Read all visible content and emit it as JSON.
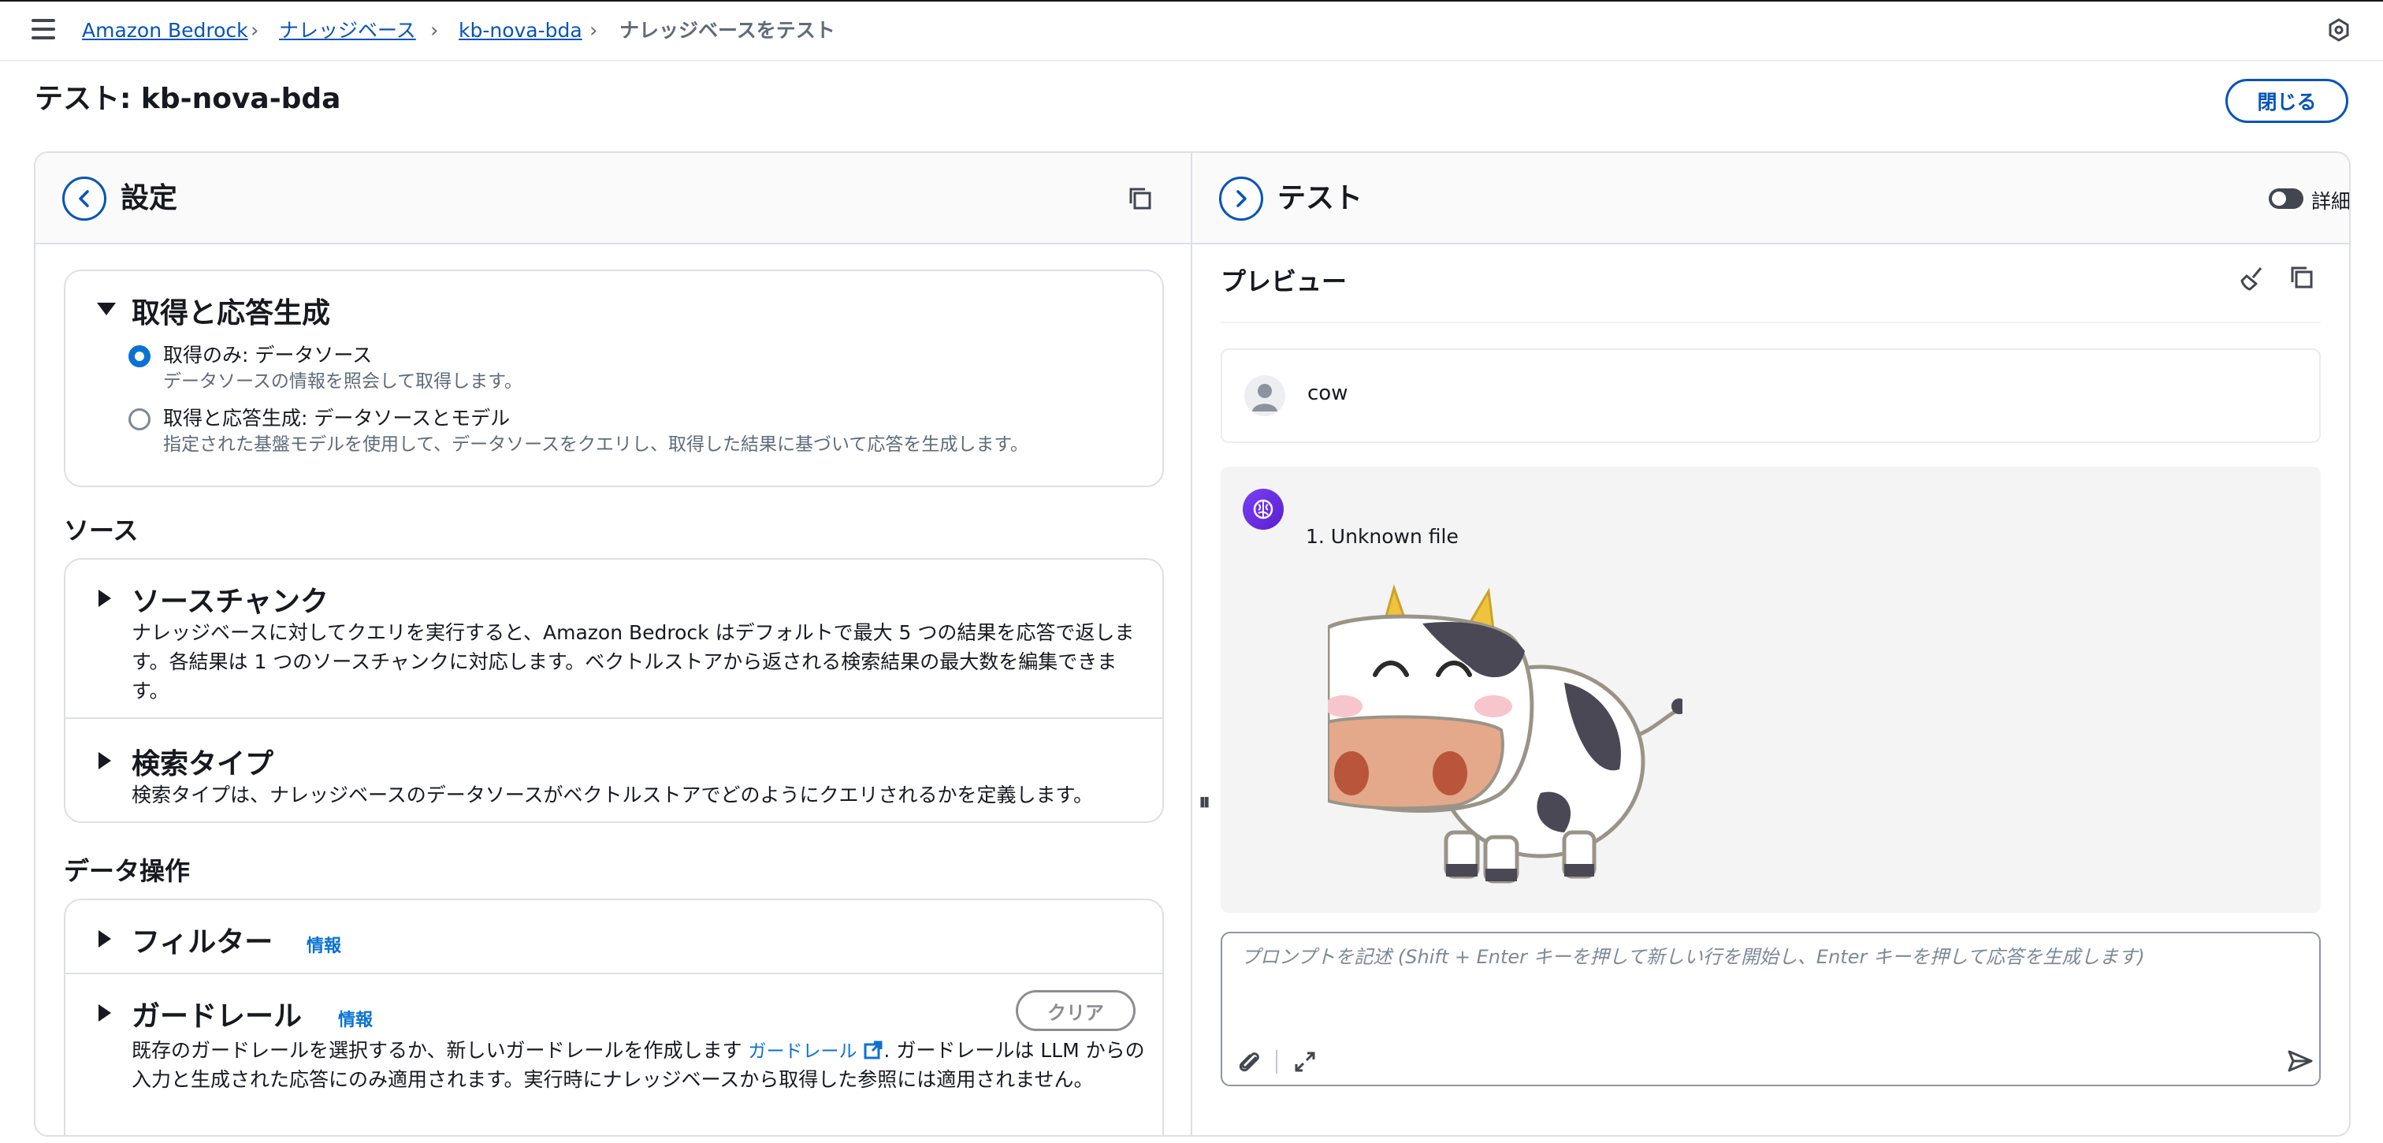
{
  "breadcrumbs": [
    "Amazon Bedrock",
    "ナレッジベース",
    "kb-nova-bda",
    "ナレッジベースをテスト"
  ],
  "page": {
    "title": "テスト: kb-nova-bda",
    "close_label": "閉じる"
  },
  "config_pane": {
    "title": "設定",
    "retrieval": {
      "title": "取得と応答生成",
      "options": [
        {
          "label": "取得のみ: データソース",
          "desc": "データソースの情報を照会して取得します。",
          "selected": true
        },
        {
          "label": "取得と応答生成: データソースとモデル",
          "desc": "指定された基盤モデルを使用して、データソースをクエリし、取得した結果に基づいて応答を生成します。",
          "selected": false
        }
      ]
    },
    "source": {
      "heading": "ソース",
      "chunks_title": "ソースチャンク",
      "chunks_desc_1": "ナレッジベースに対してクエリを実行すると、Amazon Bedrock はデフォルトで最大 5 つの結果を応答で返しま",
      "chunks_desc_2": "す。各結果は 1 つのソースチャンクに対応します。ベクトルストアから返される検索結果の最大数を編集できま",
      "chunks_desc_3": "す。",
      "search_title": "検索タイプ",
      "search_desc": "検索タイプは、ナレッジベースのデータソースがベクトルストアでどのようにクエリされるかを定義します。"
    },
    "data_ops": {
      "heading": "データ操作",
      "filter_title": "フィルター",
      "filter_info": "情報",
      "guardrail_title": "ガードレール",
      "guardrail_info": "情報",
      "clear_label": "クリア",
      "guardrail_desc_1": "既存のガードレールを選択するか、新しいガードレールを作成します",
      "guardrail_link": "ガードレール",
      "guardrail_desc_2": ". ガードレールは LLM からの",
      "guardrail_desc_3": "入力と生成された応答にのみ適用されます。実行時にナレッジベースから取得した参照には適用されません。"
    }
  },
  "test_pane": {
    "title": "テスト",
    "details_label": "詳細",
    "details_on": false,
    "preview_label": "プレビュー",
    "user_message": "cow",
    "bot_result": "1. Unknown file",
    "prompt_placeholder": "プロンプトを記述 (Shift + Enter キーを押して新しい行を開始し、Enter キーを押して応答を生成します)"
  },
  "colors": {
    "link": "#0654b8",
    "accent": "#0972d3",
    "bot_avatar": "#6b2ee3"
  }
}
